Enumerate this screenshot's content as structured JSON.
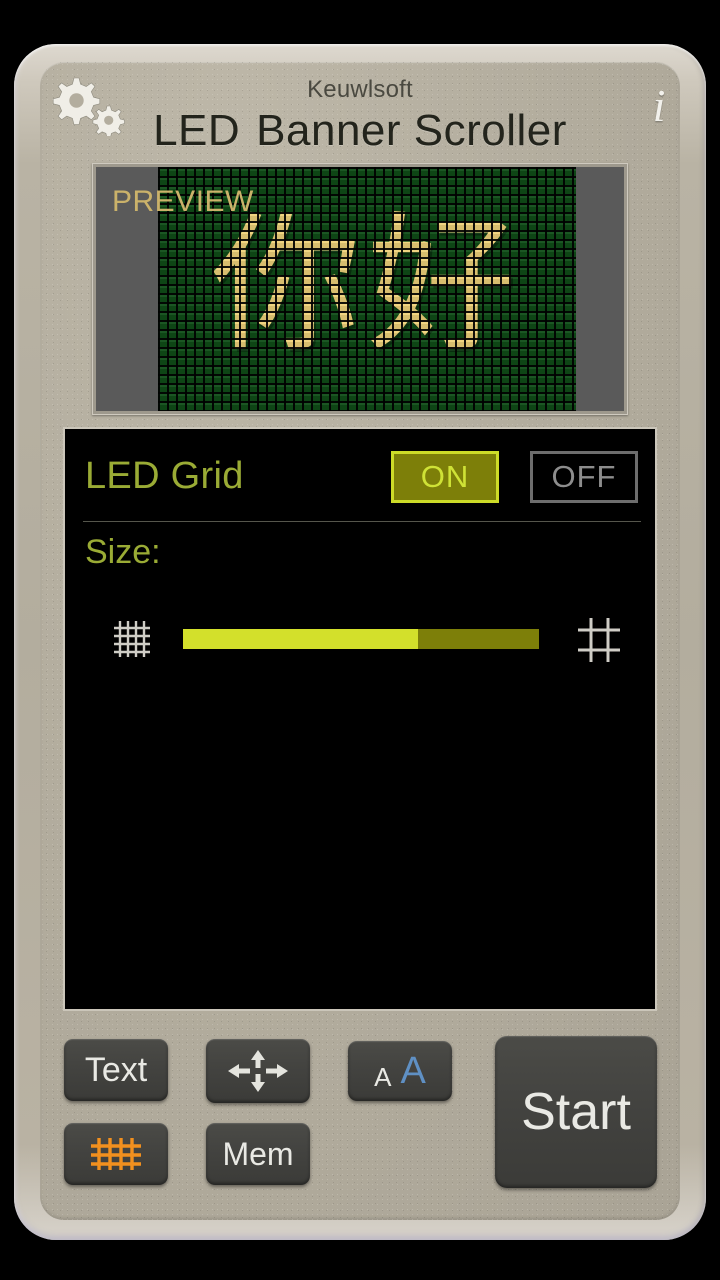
{
  "header": {
    "brand": "Keuwlsoft",
    "title_part1": "LED",
    "title_part2": "Banner Scroller",
    "settings_icon": "gears-icon",
    "info_icon": "info-icon",
    "info_glyph": "i"
  },
  "preview": {
    "label": "PREVIEW",
    "message_text": "你好",
    "led_on_color": "#efd27a",
    "led_off_color": "#0f4d17",
    "surround_color": "#5a5a5a",
    "label_color": "#cbb26a"
  },
  "settings": {
    "led_grid": {
      "label": "LED Grid",
      "on_label": "ON",
      "off_label": "OFF",
      "selected": "ON",
      "on_color": "#cddc28",
      "off_color": "#8d8d8d"
    },
    "size": {
      "label": "Size:",
      "min_icon": "fine-grid-icon",
      "max_icon": "coarse-grid-icon",
      "percent": 66
    },
    "label_color": "#9aab35"
  },
  "toolbar": {
    "text_label": "Text",
    "direction_icon": "four-arrows-icon",
    "font_size_icon": "font-size-icon",
    "font_a_small": "A",
    "font_a_large": "A",
    "grid_icon": "grid-icon",
    "grid_icon_color": "#f2901e",
    "mem_label": "Mem",
    "start_label": "Start"
  }
}
